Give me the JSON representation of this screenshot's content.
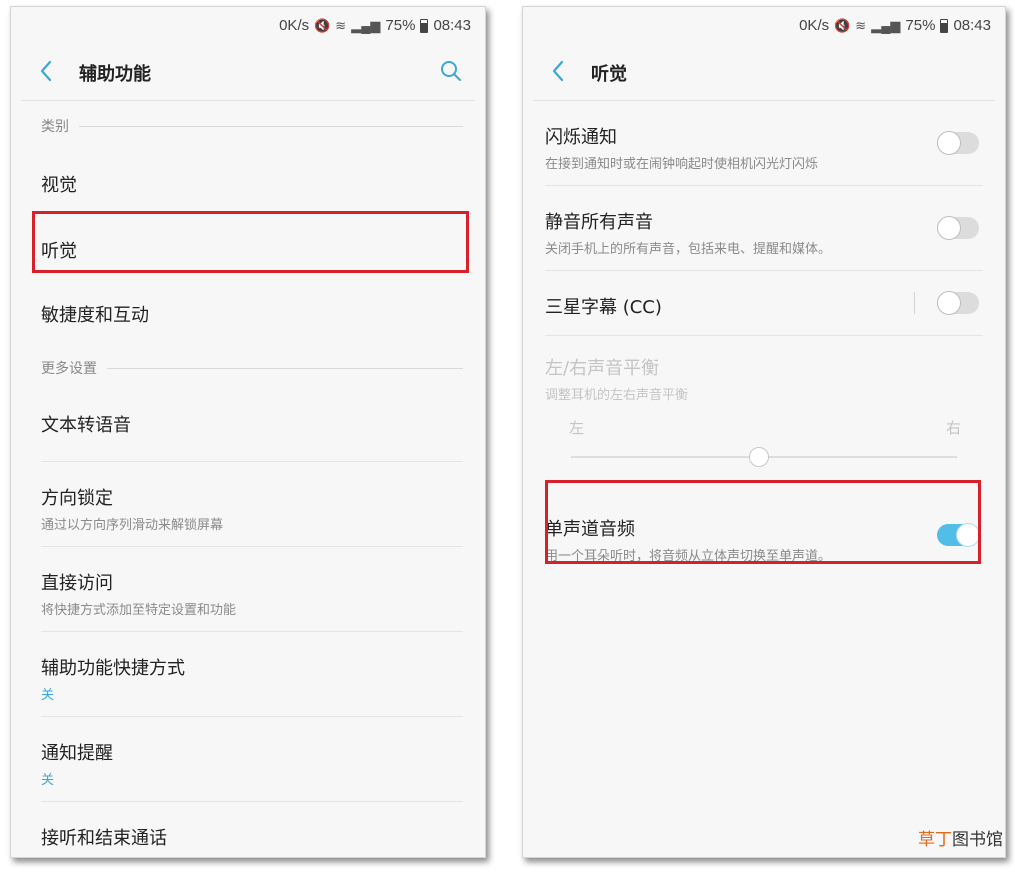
{
  "status": {
    "speed": "0K/s",
    "battery": "75%",
    "time": "08:43"
  },
  "left": {
    "title": "辅助功能",
    "section_category": "类别",
    "section_more": "更多设置",
    "items_top": [
      {
        "title": "视觉"
      },
      {
        "title": "听觉"
      },
      {
        "title": "敏捷度和互动"
      }
    ],
    "items_more": [
      {
        "title": "文本转语音"
      },
      {
        "title": "方向锁定",
        "sub": "通过以方向序列滑动来解锁屏幕"
      },
      {
        "title": "直接访问",
        "sub": "将快捷方式添加至特定设置和功能"
      },
      {
        "title": "辅助功能快捷方式",
        "sub": "关"
      },
      {
        "title": "通知提醒",
        "sub": "关"
      },
      {
        "title": "接听和结束通话"
      }
    ]
  },
  "right": {
    "title": "听觉",
    "items": [
      {
        "title": "闪烁通知",
        "sub": "在接到通知时或在闹钟响起时使相机闪光灯闪烁",
        "on": false
      },
      {
        "title": "静音所有声音",
        "sub": "关闭手机上的所有声音，包括来电、提醒和媒体。",
        "on": false
      },
      {
        "title": "三星字幕 (CC)",
        "on": false
      }
    ],
    "balance": {
      "title": "左/右声音平衡",
      "sub": "调整耳机的左右声音平衡",
      "left": "左",
      "right": "右",
      "value": 0.5
    },
    "mono": {
      "title": "单声道音频",
      "sub": "用一个耳朵听时，将音频从立体声切换至单声道。",
      "on": true
    }
  },
  "watermark": {
    "part1": "草丁",
    "part2": "图书馆"
  },
  "colors": {
    "accent": "#3ba7d5",
    "highlight": "#d7202a",
    "toggle_on": "#52bde6"
  }
}
